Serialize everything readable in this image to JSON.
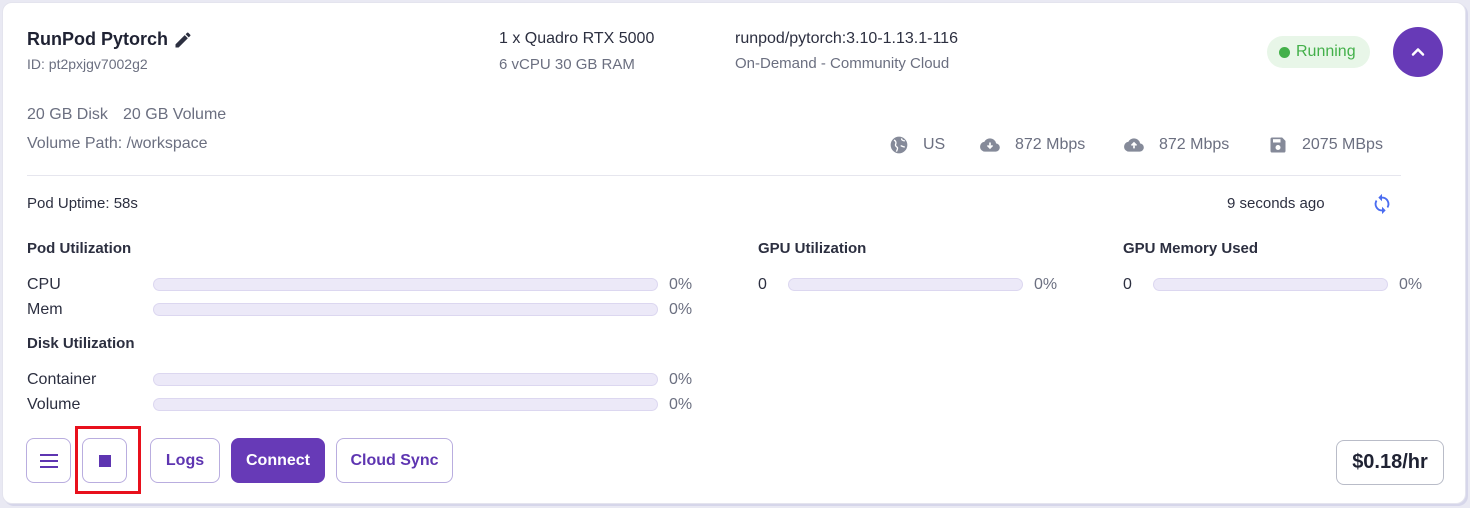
{
  "pod": {
    "name": "RunPod Pytorch",
    "id": "ID: pt2pxjgv7002g2",
    "gpu": "1 x Quadro RTX 5000",
    "resources": "6 vCPU 30 GB RAM",
    "image": "runpod/pytorch:3.10-1.13.1-116",
    "pricing_type": "On-Demand - Community Cloud",
    "status": "Running",
    "disk": "20 GB Disk",
    "volume": "20 GB Volume",
    "volume_path": "Volume Path: /workspace"
  },
  "stats": {
    "region": "US",
    "download": "872 Mbps",
    "upload": "872 Mbps",
    "disk_speed": "2075 MBps"
  },
  "uptime": {
    "label": "Pod Uptime: 58s",
    "updated": "9 seconds ago"
  },
  "pod_utilization": {
    "title": "Pod Utilization",
    "rows": [
      {
        "label": "CPU",
        "value": "0%",
        "fill": 0
      },
      {
        "label": "Mem",
        "value": "0%",
        "fill": 0
      }
    ]
  },
  "disk_utilization": {
    "title": "Disk Utilization",
    "rows": [
      {
        "label": "Container",
        "value": "0%",
        "fill": 0
      },
      {
        "label": "Volume",
        "value": "0%",
        "fill": 0
      }
    ]
  },
  "gpu_utilization": {
    "title": "GPU Utilization",
    "index": "0",
    "value": "0%",
    "fill": 0
  },
  "gpu_memory": {
    "title": "GPU Memory Used",
    "index": "0",
    "value": "0%",
    "fill": 0
  },
  "actions": {
    "logs": "Logs",
    "connect": "Connect",
    "cloud_sync": "Cloud Sync",
    "price": "$0.18/hr"
  },
  "colors": {
    "accent": "#673ab7",
    "running": "#43b04a",
    "highlight": "#e8101c"
  }
}
